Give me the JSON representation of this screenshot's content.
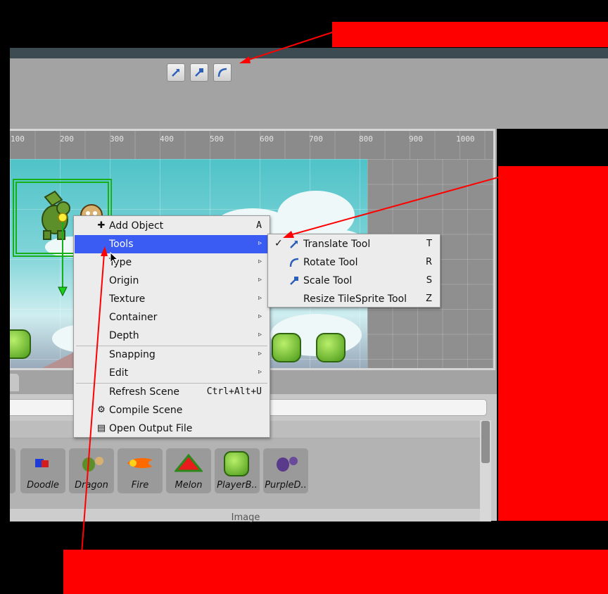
{
  "toolbar": {
    "buttons": [
      {
        "name": "translate-tool-button",
        "icon": "translate-arrow-icon"
      },
      {
        "name": "scale-tool-button",
        "icon": "scale-handle-icon"
      },
      {
        "name": "rotate-tool-button",
        "icon": "rotate-arc-icon"
      }
    ]
  },
  "ruler": {
    "labels": [
      "100",
      "200",
      "300",
      "400",
      "500",
      "600",
      "700",
      "800",
      "900",
      "1000"
    ]
  },
  "context_menu": {
    "items": [
      {
        "label": "Add Object",
        "shortcut": "A",
        "icon": "plus-icon"
      },
      {
        "label": "Tools",
        "submenu": true,
        "highlighted": true
      },
      {
        "label": "Type",
        "submenu": true
      },
      {
        "label": "Origin",
        "submenu": true
      },
      {
        "label": "Texture",
        "submenu": true
      },
      {
        "label": "Container",
        "submenu": true
      },
      {
        "label": "Depth",
        "submenu": true
      },
      {
        "label": "Snapping",
        "submenu": true
      },
      {
        "label": "Edit",
        "submenu": true
      },
      {
        "label": "Refresh Scene",
        "shortcut": "Ctrl+Alt+U"
      },
      {
        "label": "Compile Scene",
        "icon": "gear-icon"
      },
      {
        "label": "Open Output File",
        "icon": "file-icon"
      }
    ],
    "arrow": "▹"
  },
  "tools_submenu": {
    "items": [
      {
        "label": "Translate Tool",
        "shortcut": "T",
        "checked": true,
        "check": "✓"
      },
      {
        "label": "Rotate Tool",
        "shortcut": "R"
      },
      {
        "label": "Scale Tool",
        "shortcut": "S"
      },
      {
        "label": "Resize TileSprite Tool",
        "shortcut": "Z"
      }
    ]
  },
  "assets": {
    "items": [
      {
        "label": "Doodle"
      },
      {
        "label": "Dragon"
      },
      {
        "label": "Fire"
      },
      {
        "label": "Melon"
      },
      {
        "label": "PlayerB.."
      },
      {
        "label": "PurpleD.."
      }
    ],
    "section_label": "Image"
  },
  "colors": {
    "highlight": "#3a5cf2",
    "selection": "#18b018",
    "annotation": "#ff0000"
  }
}
